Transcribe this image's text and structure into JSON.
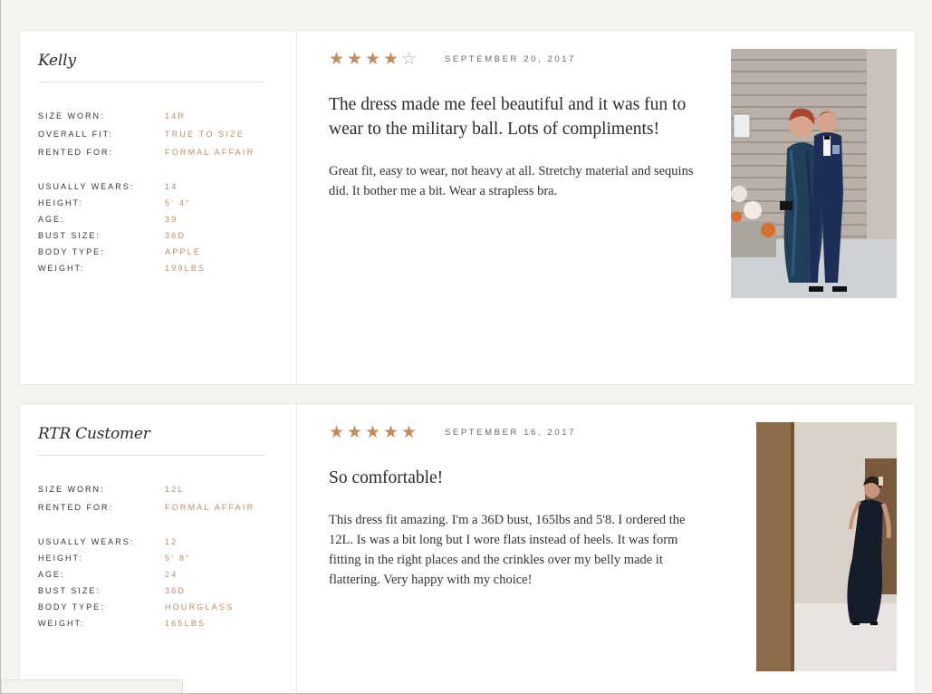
{
  "reviews": [
    {
      "reviewer_name": "Kelly",
      "stats_primary": [
        {
          "label": "Size worn:",
          "value": "14R"
        },
        {
          "label": "Overall fit:",
          "value": "True to size"
        },
        {
          "label": "Rented for:",
          "value": "Formal affair"
        }
      ],
      "stats_secondary": [
        {
          "label": "Usually wears:",
          "value": "14"
        },
        {
          "label": "Height:",
          "value": "5' 4\""
        },
        {
          "label": "Age:",
          "value": "39"
        },
        {
          "label": "Bust size:",
          "value": "36D"
        },
        {
          "label": "Body type:",
          "value": "Apple"
        },
        {
          "label": "Weight:",
          "value": "199lbs"
        }
      ],
      "rating": 4,
      "rating_max": 5,
      "date": "September 20, 2017",
      "title": "The dress made me feel beautiful and it was fun to wear to the military ball. Lots of compliments!",
      "body": "Great fit, easy to wear, not heavy at all. Stretchy material and sequins did. It bother me a bit. Wear a strapless bra.",
      "photo_icon": "customer-photo"
    },
    {
      "reviewer_name": "RTR Customer",
      "stats_primary": [
        {
          "label": "Size worn:",
          "value": "12L"
        },
        {
          "label": "Rented for:",
          "value": "Formal affair"
        }
      ],
      "stats_secondary": [
        {
          "label": "Usually wears:",
          "value": "12"
        },
        {
          "label": "Height:",
          "value": "5' 8\""
        },
        {
          "label": "Age:",
          "value": "24"
        },
        {
          "label": "Bust size:",
          "value": "36D"
        },
        {
          "label": "Body type:",
          "value": "Hourglass"
        },
        {
          "label": "Weight:",
          "value": "165lbs"
        }
      ],
      "rating": 5,
      "rating_max": 5,
      "date": "September 16, 2017",
      "title": "So comfortable!",
      "body": "This dress fit amazing. I'm a 36D bust, 165lbs and 5'8. I ordered the 12L. Is was a bit long but I wore flats instead of heels. It was form fitting in the right places and the crinkles over my belly made it flattering. Very happy with my choice!",
      "photo_icon": "customer-photo"
    }
  ],
  "colors": {
    "accent": "#c48c5c",
    "stat_value": "#b98a63",
    "background": "#f6f4f0",
    "card": "#ffffff"
  }
}
